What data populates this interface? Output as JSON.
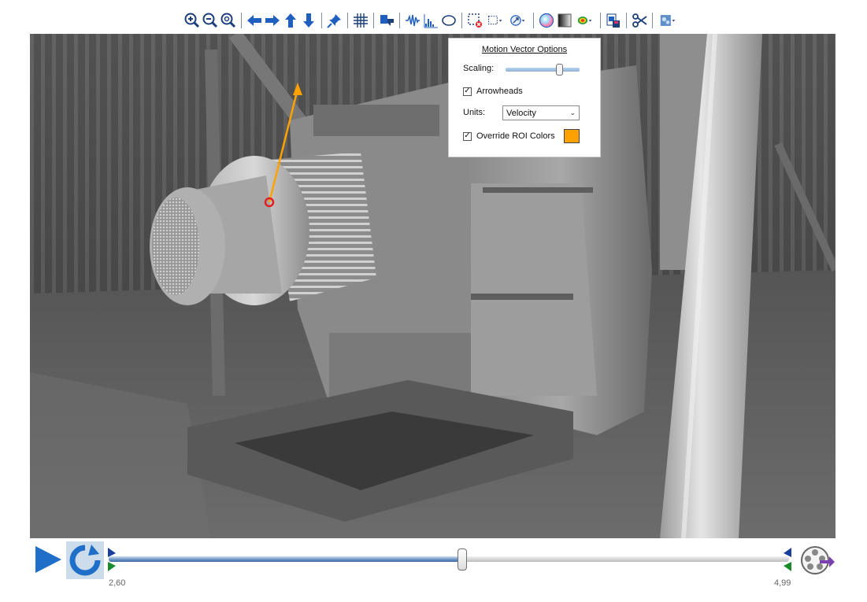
{
  "toolbar": {
    "icons": [
      "zoom-in-icon",
      "zoom-out-icon",
      "zoom-fit-icon",
      "pan-left-icon",
      "pan-right-icon",
      "pan-up-icon",
      "pan-down-icon",
      "pin-icon",
      "grid-icon",
      "flip-icon",
      "waveform-icon",
      "histogram-icon",
      "ellipse-roi-icon",
      "rect-roi-delete-icon",
      "rect-roi-icon",
      "motion-vector-icon",
      "color-wheel-icon",
      "grayscale-icon",
      "heatmap-icon",
      "save-icon",
      "scissors-icon",
      "settings-icon"
    ],
    "colors": {
      "primary": "#1f5fbf",
      "navy": "#1a3f7a",
      "orange": "#ffa200"
    }
  },
  "motion_vector_options": {
    "title": "Motion Vector Options",
    "scaling_label": "Scaling:",
    "scaling_value": 0.72,
    "arrowheads_label": "Arrowheads",
    "arrowheads_checked": true,
    "units_label": "Units:",
    "units_value": "Velocity",
    "override_label": "Override ROI Colors",
    "override_checked": true,
    "override_color": "#ffa200"
  },
  "timeline": {
    "start_label": "2,60",
    "end_label": "4,99",
    "position": 0.52
  }
}
